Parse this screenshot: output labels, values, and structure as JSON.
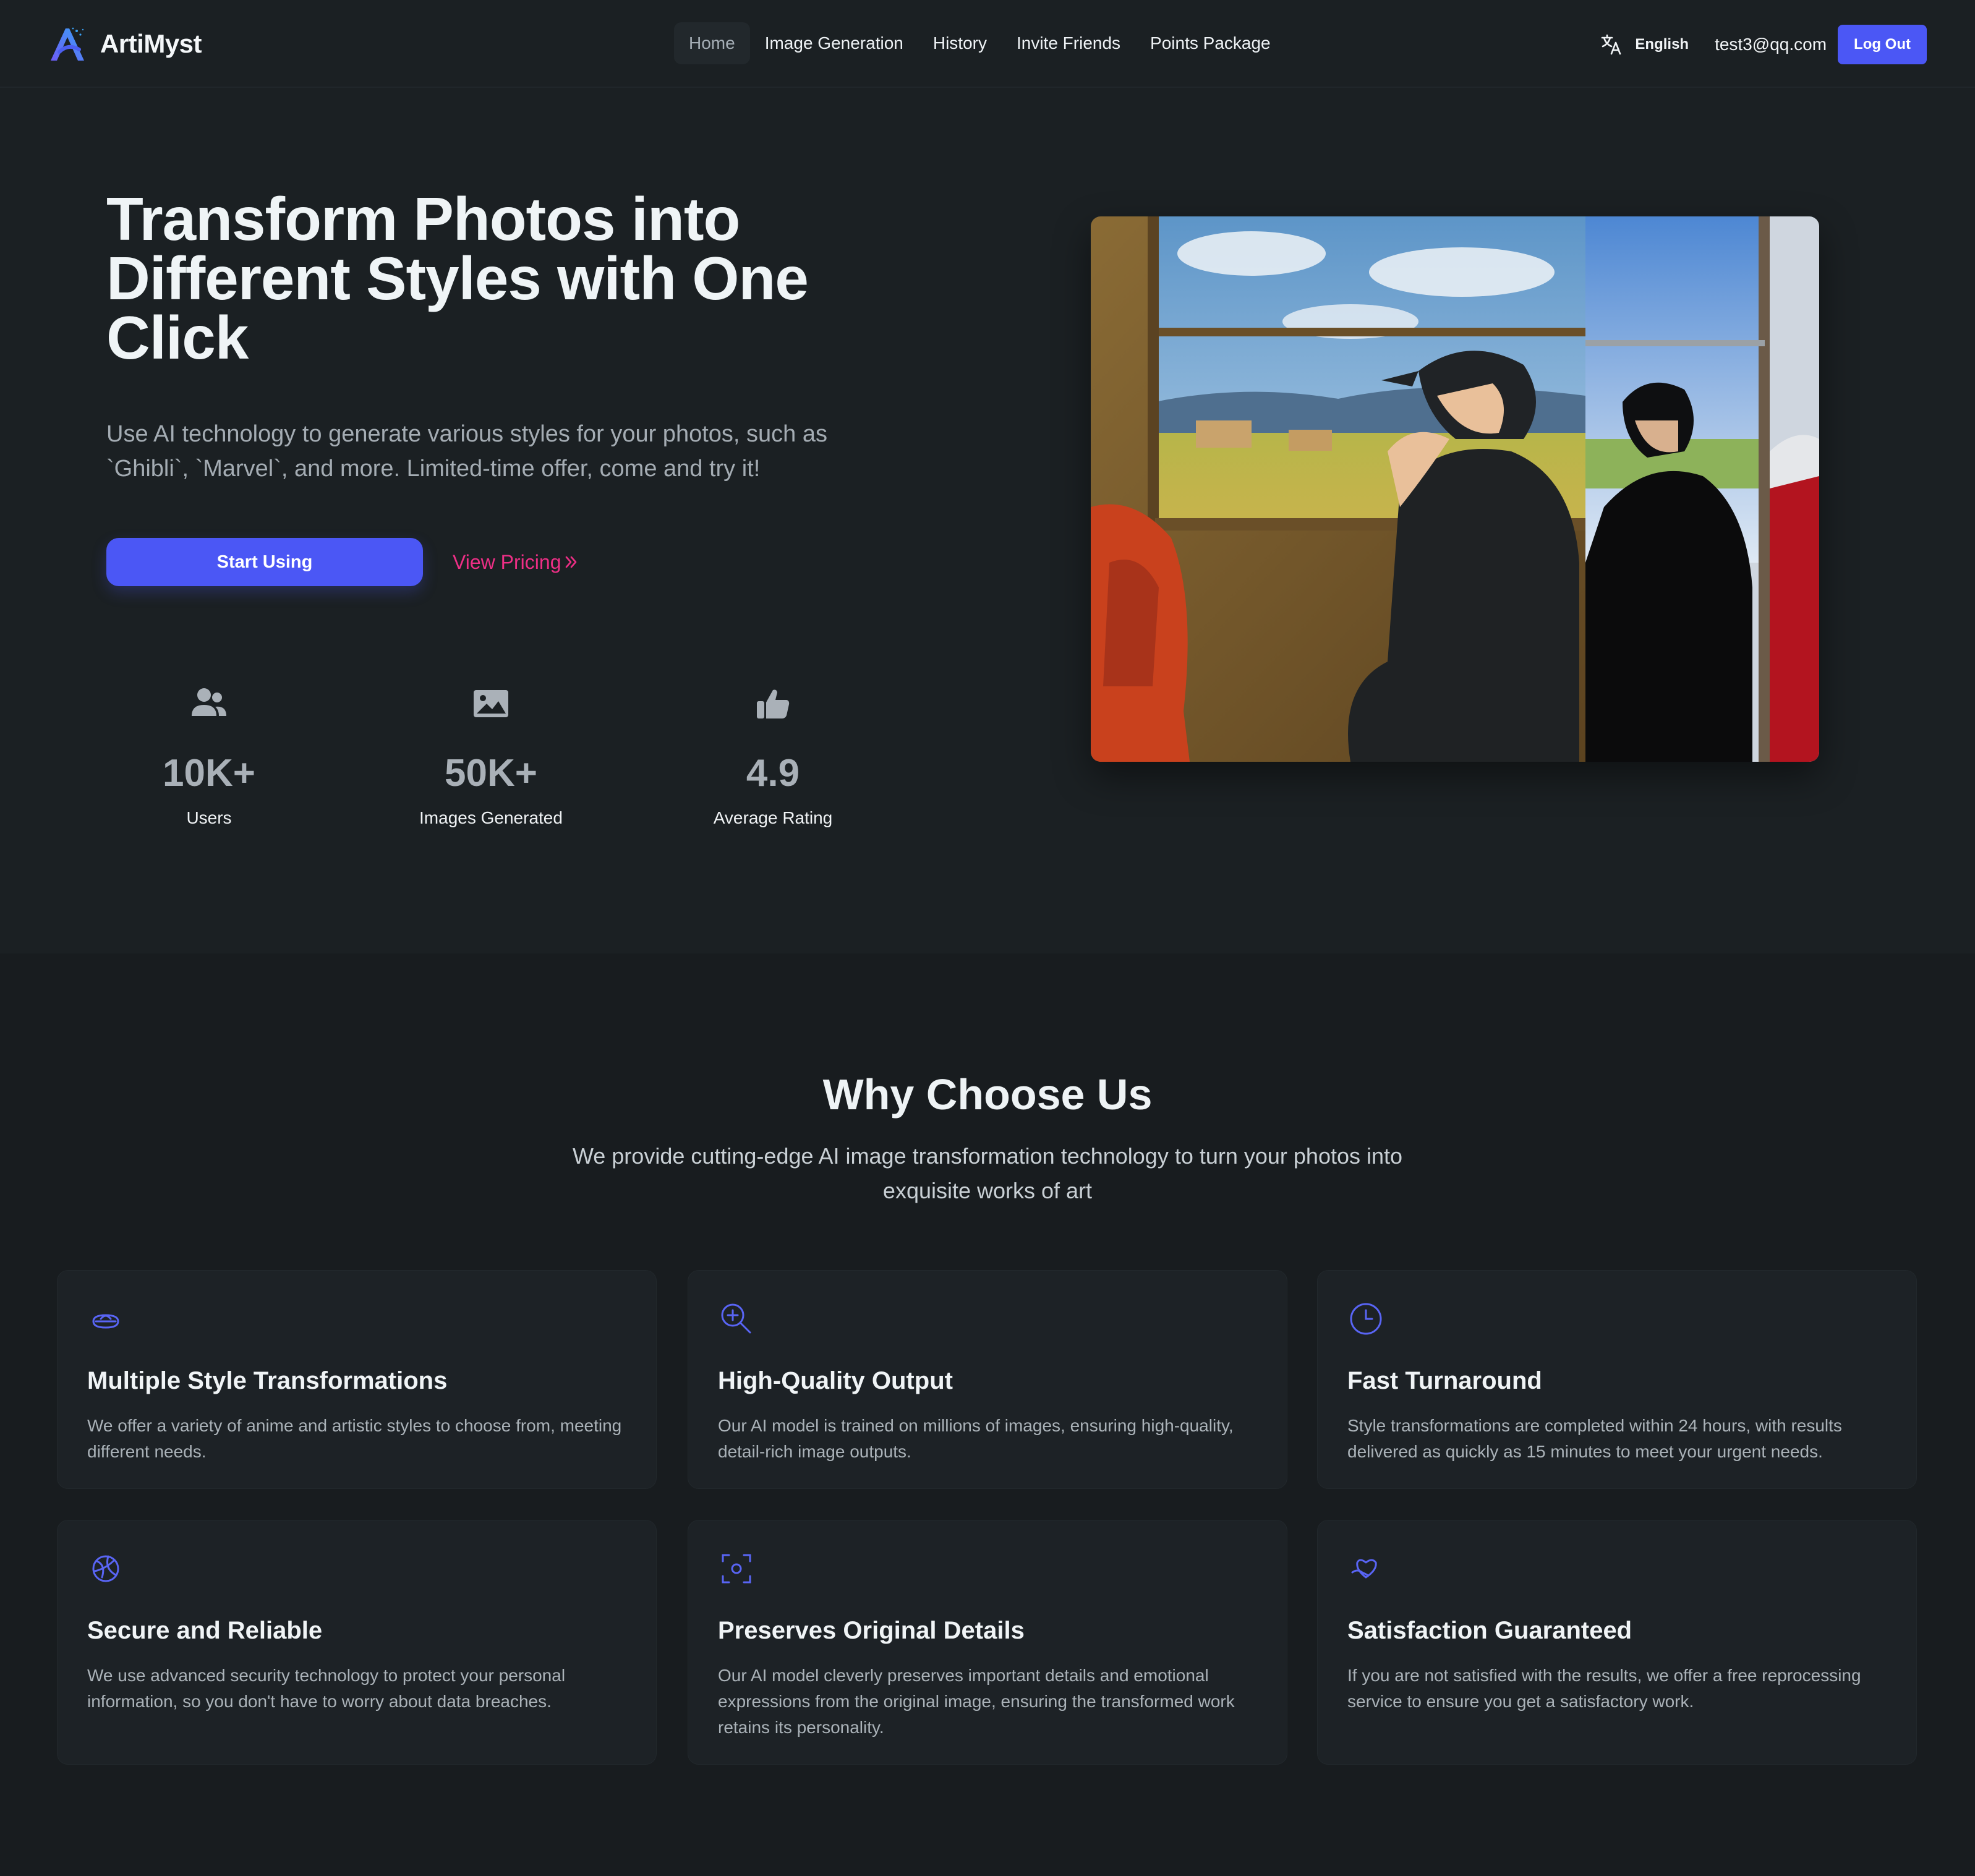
{
  "nav": {
    "brand": "ArtiMyst",
    "links": [
      {
        "label": "Home",
        "active": true
      },
      {
        "label": "Image Generation"
      },
      {
        "label": "History"
      },
      {
        "label": "Invite Friends"
      },
      {
        "label": "Points Package"
      }
    ],
    "language": "English",
    "user_email": "test3@qq.com",
    "logout_label": "Log Out"
  },
  "hero": {
    "title": "Transform Photos into Different Styles with One Click",
    "subtitle": "Use AI technology to generate various styles for your photos, such as `Ghibli`, `Marvel`, and more. Limited-time offer, come and try it!",
    "start_label": "Start Using",
    "pricing_label": "View Pricing",
    "stats": [
      {
        "icon": "users-icon",
        "value": "10K+",
        "label": "Users"
      },
      {
        "icon": "image-icon",
        "value": "50K+",
        "label": "Images Generated"
      },
      {
        "icon": "thumbs-up-icon",
        "value": "4.9",
        "label": "Average Rating"
      }
    ]
  },
  "why": {
    "title": "Why Choose Us",
    "subtitle": "We provide cutting-edge AI image transformation technology to turn your photos into exquisite works of art",
    "cards": [
      {
        "icon": "style-icon",
        "title": "Multiple Style Transformations",
        "desc": "We offer a variety of anime and artistic styles to choose from, meeting different needs."
      },
      {
        "icon": "zoom-in-icon",
        "title": "High-Quality Output",
        "desc": "Our AI model is trained on millions of images, ensuring high-quality, detail-rich image outputs."
      },
      {
        "icon": "clock-icon",
        "title": "Fast Turnaround",
        "desc": "Style transformations are completed within 24 hours, with results delivered as quickly as 15 minutes to meet your urgent needs."
      },
      {
        "icon": "security-icon",
        "title": "Secure and Reliable",
        "desc": "We use advanced security technology to protect your personal information, so you don't have to worry about data breaches."
      },
      {
        "icon": "focus-icon",
        "title": "Preserves Original Details",
        "desc": "Our AI model cleverly preserves important details and emotional expressions from the original image, ensuring the transformed work retains its personality."
      },
      {
        "icon": "heart-hand-icon",
        "title": "Satisfaction Guaranteed",
        "desc": "If you are not satisfied with the results, we offer a free reprocessing service to ensure you get a satisfactory work."
      }
    ]
  },
  "colors": {
    "accent": "#4b57f5",
    "pricing_link": "#ee2f86",
    "background": "#1b2023",
    "card": "#1d2226"
  }
}
